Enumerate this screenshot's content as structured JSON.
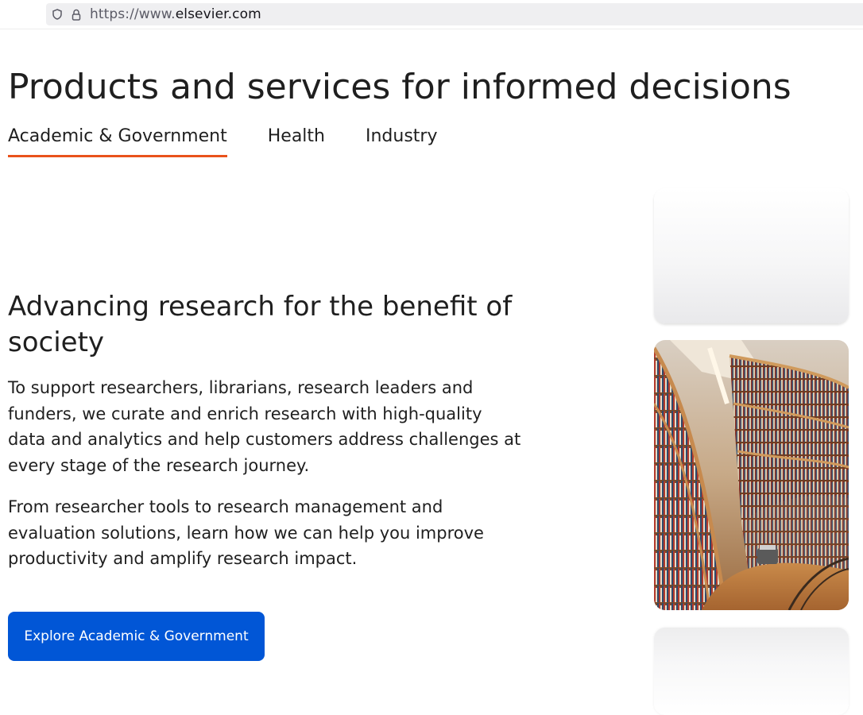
{
  "browser": {
    "url_prefix": "https://www.",
    "url_domain": "elsevier.com",
    "icons": [
      "shield-icon",
      "lock-icon"
    ]
  },
  "page": {
    "title": "Products and services for informed decisions"
  },
  "tabs": [
    {
      "label": "Academic & Government",
      "active": true
    },
    {
      "label": "Health",
      "active": false
    },
    {
      "label": "Industry",
      "active": false
    }
  ],
  "section": {
    "heading": "Advancing research for the benefit of society",
    "paragraph1": "To support researchers, librarians, research leaders and funders, we curate and enrich research with high-quality data and analytics and help customers address challenges at every stage of the research journey.",
    "paragraph2": "From researcher tools to research management and evaluation solutions, learn how we can help you improve productivity and amplify research impact.",
    "cta_label": "Explore Academic & Government"
  },
  "colors": {
    "accent_underline": "#e9521b",
    "cta_background": "#0156d6",
    "text": "#1f1f1f"
  }
}
